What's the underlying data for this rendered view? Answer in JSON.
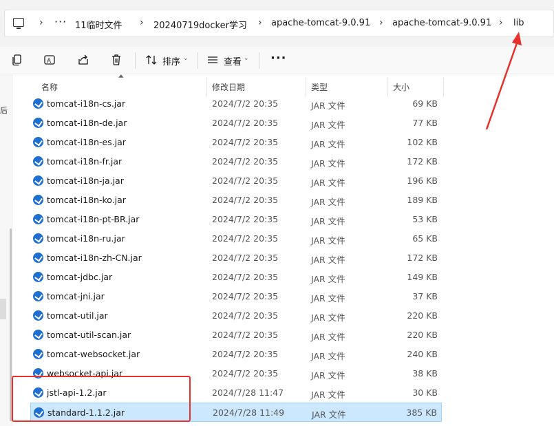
{
  "address_bar": {
    "crumbs": [
      "11临时文件",
      "20240719docker学习",
      "apache-tomcat-9.0.91",
      "apache-tomcat-9.0.91",
      "lib"
    ],
    "overflow": "···"
  },
  "toolbar": {
    "sort_label": "排序",
    "view_label": "查看",
    "more_label": "···"
  },
  "nav_fragment": "后",
  "columns": {
    "name": "名称",
    "date": "修改日期",
    "type": "类型",
    "size": "大小"
  },
  "files": [
    {
      "name": "tomcat-i18n-cs.jar",
      "date": "2024/7/2 20:35",
      "type": "JAR 文件",
      "size": "69 KB"
    },
    {
      "name": "tomcat-i18n-de.jar",
      "date": "2024/7/2 20:35",
      "type": "JAR 文件",
      "size": "77 KB"
    },
    {
      "name": "tomcat-i18n-es.jar",
      "date": "2024/7/2 20:35",
      "type": "JAR 文件",
      "size": "102 KB"
    },
    {
      "name": "tomcat-i18n-fr.jar",
      "date": "2024/7/2 20:35",
      "type": "JAR 文件",
      "size": "172 KB"
    },
    {
      "name": "tomcat-i18n-ja.jar",
      "date": "2024/7/2 20:35",
      "type": "JAR 文件",
      "size": "196 KB"
    },
    {
      "name": "tomcat-i18n-ko.jar",
      "date": "2024/7/2 20:35",
      "type": "JAR 文件",
      "size": "189 KB"
    },
    {
      "name": "tomcat-i18n-pt-BR.jar",
      "date": "2024/7/2 20:35",
      "type": "JAR 文件",
      "size": "53 KB"
    },
    {
      "name": "tomcat-i18n-ru.jar",
      "date": "2024/7/2 20:35",
      "type": "JAR 文件",
      "size": "65 KB"
    },
    {
      "name": "tomcat-i18n-zh-CN.jar",
      "date": "2024/7/2 20:35",
      "type": "JAR 文件",
      "size": "172 KB"
    },
    {
      "name": "tomcat-jdbc.jar",
      "date": "2024/7/2 20:35",
      "type": "JAR 文件",
      "size": "149 KB"
    },
    {
      "name": "tomcat-jni.jar",
      "date": "2024/7/2 20:35",
      "type": "JAR 文件",
      "size": "37 KB"
    },
    {
      "name": "tomcat-util.jar",
      "date": "2024/7/2 20:35",
      "type": "JAR 文件",
      "size": "220 KB"
    },
    {
      "name": "tomcat-util-scan.jar",
      "date": "2024/7/2 20:35",
      "type": "JAR 文件",
      "size": "220 KB"
    },
    {
      "name": "tomcat-websocket.jar",
      "date": "2024/7/2 20:35",
      "type": "JAR 文件",
      "size": "240 KB"
    },
    {
      "name": "websocket-api.jar",
      "date": "2024/7/2 20:35",
      "type": "JAR 文件",
      "size": "38 KB"
    },
    {
      "name": "jstl-api-1.2.jar",
      "date": "2024/7/28 11:47",
      "type": "JAR 文件",
      "size": "30 KB"
    },
    {
      "name": "standard-1.1.2.jar",
      "date": "2024/7/28 11:49",
      "type": "JAR 文件",
      "size": "385 KB",
      "selected": true
    }
  ],
  "colors": {
    "selection_bg": "#cce8ff",
    "selection_border": "#99d1ff",
    "annotation_red": "#e8302a",
    "jar_icon_blue": "#1e6fd0"
  }
}
